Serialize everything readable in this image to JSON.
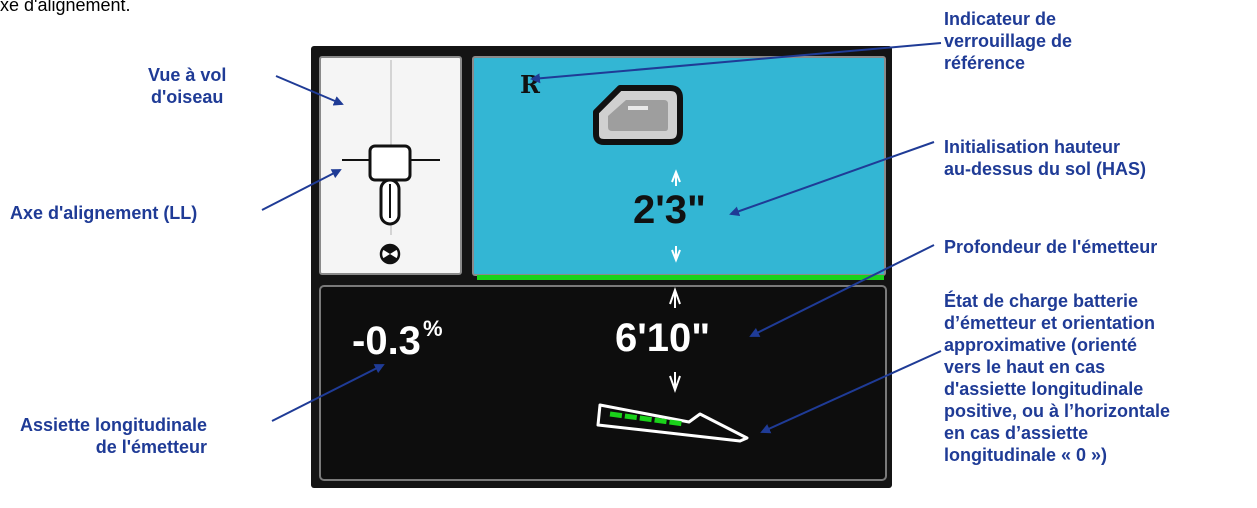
{
  "caption": "xe d'alignement.",
  "screen": {
    "reference_letter": "R",
    "height_above_ground": "2'3\"",
    "transmitter_depth": "6'10\"",
    "pitch_value": "-0.3",
    "pitch_unit": "%",
    "colors": {
      "blue_panel": "#33b6d4",
      "status_line": "#1ad21a",
      "background": "#141414"
    },
    "icons": [
      "reference-lock-icon",
      "up-arrow-icon",
      "down-arrow-icon",
      "locator-icon",
      "transmitter-battery-icon",
      "target-icon"
    ]
  },
  "callouts": {
    "birds_eye": [
      "Vue à vol",
      "d'oiseau"
    ],
    "locate_line": "Axe d'alignement (LL)",
    "pitch": [
      "Assiette longitudinale",
      "de l'émetteur"
    ],
    "reference_lock": [
      "Indicateur de",
      "verrouillage de",
      "référence"
    ],
    "hag": [
      "Initialisation hauteur",
      "au-dessus du sol (HAS)"
    ],
    "depth": "Profondeur de l'émetteur",
    "battery": [
      "État de charge batterie",
      "d’émetteur et orientation",
      "approximative (orienté",
      "vers le haut en cas",
      "d'assiette longitudinale",
      "positive, ou à l’horizontale",
      "en cas d’assiette",
      "longitudinale « 0 »)"
    ]
  }
}
